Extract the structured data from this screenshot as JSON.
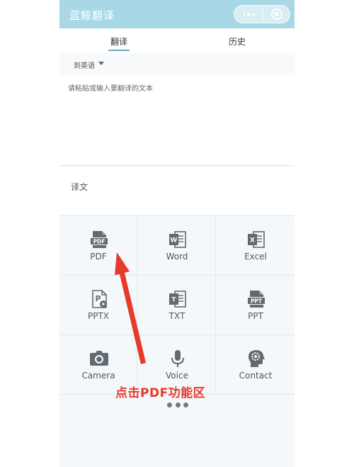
{
  "header": {
    "title": "蓝鲸翻译"
  },
  "tabs": [
    {
      "label": "翻译"
    },
    {
      "label": "历史"
    }
  ],
  "language": {
    "target": "到英语"
  },
  "input": {
    "placeholder": "请粘贴或输入要翻译的文本",
    "value": ""
  },
  "result": {
    "label": "译文"
  },
  "tools": [
    {
      "label": "PDF",
      "icon": "pdf-file-icon"
    },
    {
      "label": "Word",
      "icon": "word-file-icon"
    },
    {
      "label": "Excel",
      "icon": "excel-file-icon"
    },
    {
      "label": "PPTX",
      "icon": "pptx-file-icon"
    },
    {
      "label": "TXT",
      "icon": "txt-file-icon"
    },
    {
      "label": "PPT",
      "icon": "ppt-file-icon"
    },
    {
      "label": "Camera",
      "icon": "camera-icon"
    },
    {
      "label": "Voice",
      "icon": "microphone-icon"
    },
    {
      "label": "Contact",
      "icon": "contact-gear-icon"
    }
  ],
  "annotation": {
    "text": "点击PDF功能区",
    "color": "#e8392a"
  },
  "colors": {
    "header": "#a8d8e6",
    "accent": "#6fa8c4",
    "icon": "#606a70"
  }
}
